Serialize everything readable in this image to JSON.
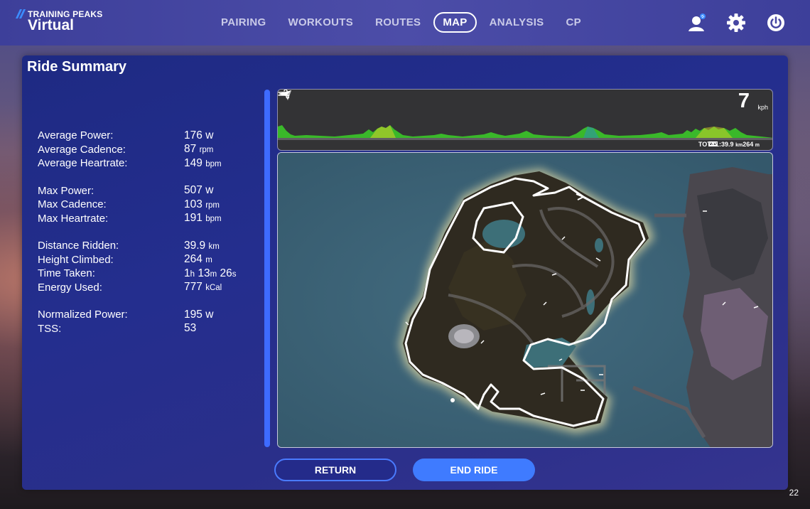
{
  "header": {
    "logo_top": "TRAINING PEAKS",
    "logo_bottom": "Virtual",
    "nav": [
      {
        "label": "PAIRING"
      },
      {
        "label": "WORKOUTS"
      },
      {
        "label": "ROUTES"
      },
      {
        "label": "MAP",
        "active": true
      },
      {
        "label": "ANALYSIS"
      },
      {
        "label": "CP"
      }
    ],
    "icons": [
      "user-profile-icon",
      "gear-icon",
      "power-icon"
    ]
  },
  "panel": {
    "title": "Ride Summary",
    "stats": [
      {
        "label": "Average Power:",
        "value": "176",
        "unit": "w"
      },
      {
        "label": "Average Cadence:",
        "value": "87",
        "unit": "rpm"
      },
      {
        "label": "Average Heartrate:",
        "value": "149",
        "unit": "bpm"
      },
      {
        "label": "Max Power:",
        "value": "507",
        "unit": "w"
      },
      {
        "label": "Max Cadence:",
        "value": "103",
        "unit": "rpm"
      },
      {
        "label": "Max Heartrate:",
        "value": "191",
        "unit": "bpm"
      },
      {
        "label": "Distance Ridden:",
        "value": "39.9",
        "unit": "km"
      },
      {
        "label": "Height Climbed:",
        "value": "264",
        "unit": "m"
      },
      {
        "label": "Time Taken:",
        "time": {
          "h": "1",
          "m": "13",
          "s": "26"
        },
        "units": {
          "h": "h",
          "m": "m",
          "s": "s"
        }
      },
      {
        "label": "Energy Used:",
        "value": "777",
        "unit": "kCal"
      },
      {
        "label": "Normalized Power:",
        "value": "195",
        "unit": "w"
      },
      {
        "label": "TSS:",
        "value": "53",
        "unit": ""
      }
    ]
  },
  "elevation": {
    "speed": "7",
    "speed_unit": "kph",
    "totals_label": "TOTAL:",
    "distance": "39.9",
    "distance_unit": "km",
    "climb": "264",
    "climb_unit": "m"
  },
  "buttons": {
    "return": "RETURN",
    "end_ride": "END RIDE"
  },
  "page_number": "22",
  "colors": {
    "accent": "#3f7bff",
    "panel": "#242e8e",
    "elevation_fill": "#3ab82a"
  }
}
